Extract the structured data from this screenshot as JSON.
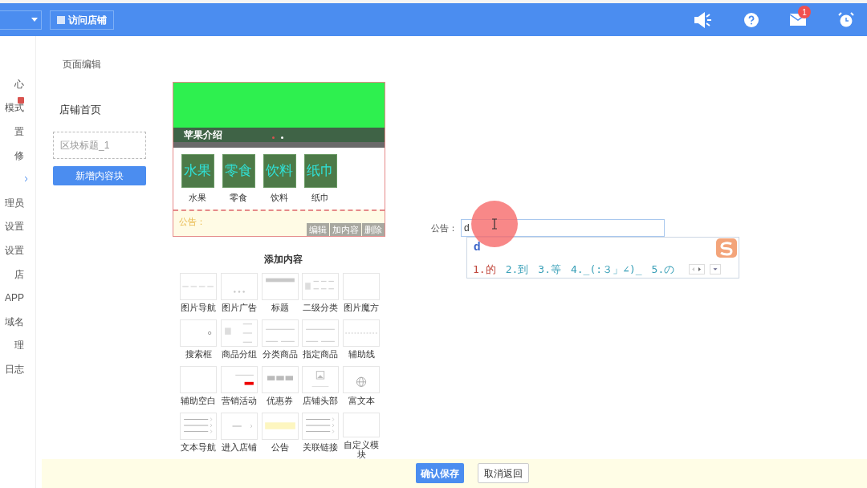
{
  "top_bar": {
    "visit_button": "访问店铺",
    "mail_badge": "1"
  },
  "sidebar": {
    "items": [
      {
        "label": "心",
        "badge": false,
        "chevron": false
      },
      {
        "label": "模式",
        "badge": true,
        "chevron": false
      },
      {
        "label": "置",
        "badge": false,
        "chevron": false
      },
      {
        "label": "修",
        "badge": false,
        "chevron": false
      },
      {
        "badge": false,
        "chevron": true
      },
      {
        "label": "理员",
        "badge": false,
        "chevron": false
      },
      {
        "label": "设置",
        "badge": false,
        "chevron": false
      },
      {
        "label": "设置",
        "badge": false,
        "chevron": false
      },
      {
        "label": "店",
        "badge": false,
        "chevron": false
      },
      {
        "label": "APP",
        "badge": false,
        "chevron": false
      },
      {
        "label": "域名",
        "badge": false,
        "chevron": false
      },
      {
        "label": "理",
        "badge": false,
        "chevron": false
      },
      {
        "label": "日志",
        "badge": false,
        "chevron": false
      }
    ]
  },
  "page_title": "页面编辑",
  "left_panel": {
    "page_name": "店铺首页",
    "block_title": {
      "placeholder": "区块标题_1"
    },
    "add_block_button": "新增内容块"
  },
  "preview": {
    "banner": {
      "caption": "苹果介绍",
      "dots": [
        {
          "selected": true
        },
        {
          "selected": false
        }
      ]
    },
    "categories": [
      {
        "tile": "水果",
        "label": "水果"
      },
      {
        "tile": "零食",
        "label": "零食"
      },
      {
        "tile": "饮料",
        "label": "饮料"
      },
      {
        "tile": "纸巾",
        "label": "纸巾"
      }
    ],
    "notice": {
      "label": "公告：",
      "actions": [
        "编辑",
        "加内容",
        "删除"
      ]
    }
  },
  "add_content": {
    "title": "添加内容",
    "items": [
      {
        "label": "图片导航",
        "kind": "dashes"
      },
      {
        "label": "图片广告",
        "kind": "dots"
      },
      {
        "label": "标题",
        "kind": "bar"
      },
      {
        "label": "二级分类",
        "kind": "subcat"
      },
      {
        "label": "图片魔方",
        "kind": "blank"
      },
      {
        "label": "搜索框",
        "kind": "search"
      },
      {
        "label": "商品分组",
        "kind": "group"
      },
      {
        "label": "分类商品",
        "kind": "lines"
      },
      {
        "label": "指定商品",
        "kind": "lines"
      },
      {
        "label": "辅助线",
        "kind": "dashline"
      },
      {
        "label": "辅助空白",
        "kind": "blank"
      },
      {
        "label": "营销活动",
        "kind": "promo"
      },
      {
        "label": "优惠券",
        "kind": "coupon"
      },
      {
        "label": "店铺头部"
      },
      {
        "label": "富文本",
        "kind": "globe"
      },
      {
        "label": "文本导航",
        "kind": "textnav"
      },
      {
        "label": "进入店铺",
        "kind": "enter"
      },
      {
        "label": "公告",
        "kind": "notice"
      },
      {
        "label": "关联链接",
        "kind": "textnav"
      },
      {
        "label": "自定义模块",
        "kind": "blank"
      }
    ]
  },
  "notice_form": {
    "label": "公告：",
    "value": "d"
  },
  "ime": {
    "composition": "d",
    "candidates": [
      {
        "text": "1.的",
        "selected": true
      },
      {
        "text": "2.到",
        "selected": false
      },
      {
        "text": "3.等",
        "selected": false
      },
      {
        "text": "4._(:３」∠)_",
        "selected": false
      },
      {
        "text": "5.の",
        "selected": false
      }
    ]
  },
  "footer": {
    "save_button": "确认保存",
    "cancel_button": "取消返回"
  }
}
